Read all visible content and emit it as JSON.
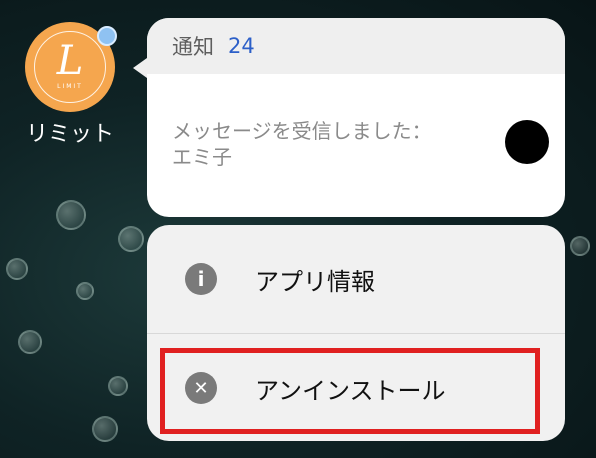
{
  "app": {
    "name": "リミット",
    "icon_letter": "L",
    "icon_small_text": "LIMIT",
    "icon_color": "#f5a64e",
    "badge_color": "#8fc2f2"
  },
  "notification": {
    "title": "通知",
    "count": "24",
    "count_color": "#2c5fc8",
    "message_line1": "メッセージを受信しました：",
    "message_line2": "エミ子"
  },
  "menu": {
    "items": [
      {
        "label": "アプリ情報",
        "icon": "info-icon",
        "icon_glyph": "i"
      },
      {
        "label": "アンインストール",
        "icon": "close-icon",
        "icon_glyph": "✕"
      }
    ],
    "highlight_color": "#e02020"
  }
}
